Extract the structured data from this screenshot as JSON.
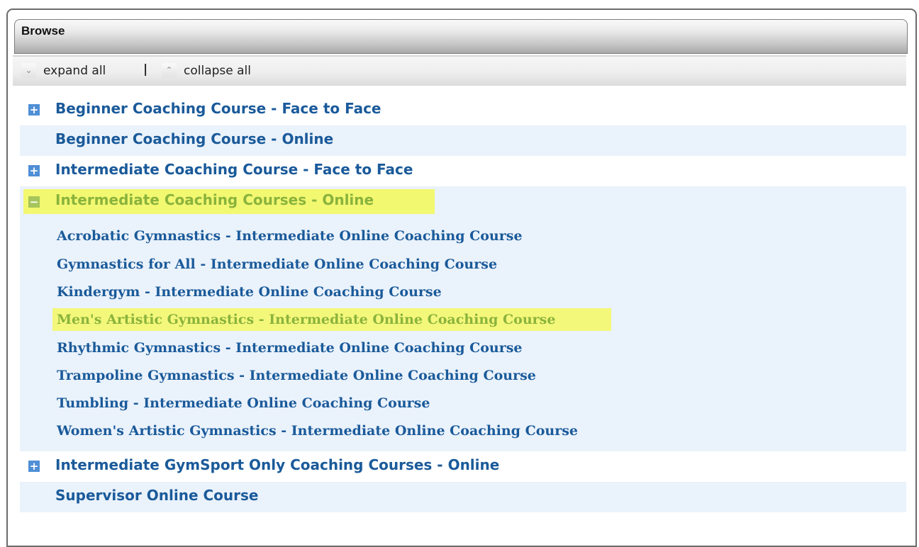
{
  "panel": {
    "title": "Browse"
  },
  "toolbar": {
    "expand_label": "expand all",
    "separator": "|",
    "collapse_label": "collapse all",
    "expand_icon": "chevron-down-icon",
    "collapse_icon": "chevron-up-icon"
  },
  "categories": [
    {
      "label": "Beginner Coaching Course - Face to Face",
      "expandable": true
    },
    {
      "label": "Beginner Coaching Course - Online",
      "expandable": false
    },
    {
      "label": "Intermediate Coaching Course - Face to Face",
      "expandable": true
    },
    {
      "label": "Intermediate Coaching Courses - Online",
      "expandable": true,
      "expanded": true,
      "highlighted": true
    },
    {
      "label": "Intermediate GymSport Only Coaching Courses - Online",
      "expandable": true
    },
    {
      "label": "Supervisor Online Course",
      "expandable": false
    }
  ],
  "subcourses": [
    {
      "label": "Acrobatic Gymnastics - Intermediate Online Coaching Course"
    },
    {
      "label": "Gymnastics for All - Intermediate Online Coaching Course"
    },
    {
      "label": "Kindergym - Intermediate Online Coaching Course"
    },
    {
      "label": "Men's Artistic Gymnastics - Intermediate Online Coaching Course",
      "highlighted": true
    },
    {
      "label": "Rhythmic Gymnastics - Intermediate Online Coaching Course"
    },
    {
      "label": "Trampoline Gymnastics - Intermediate Online Coaching Course"
    },
    {
      "label": "Tumbling - Intermediate Online Coaching Course"
    },
    {
      "label": "Women's Artistic Gymnastics - Intermediate Online Coaching Course"
    }
  ],
  "colors": {
    "link": "#1a5a9a",
    "highlight_bg": "#f2f870",
    "highlight_text": "#8ab33c",
    "row_alt": "#eaf2fb",
    "expander": "#4f8fd6"
  },
  "icons": {
    "expand": "plus-box-icon",
    "collapse": "minus-box-icon"
  },
  "glyphs": {
    "plus": "+",
    "minus": "−",
    "down": "⌄",
    "up": "⌃"
  }
}
